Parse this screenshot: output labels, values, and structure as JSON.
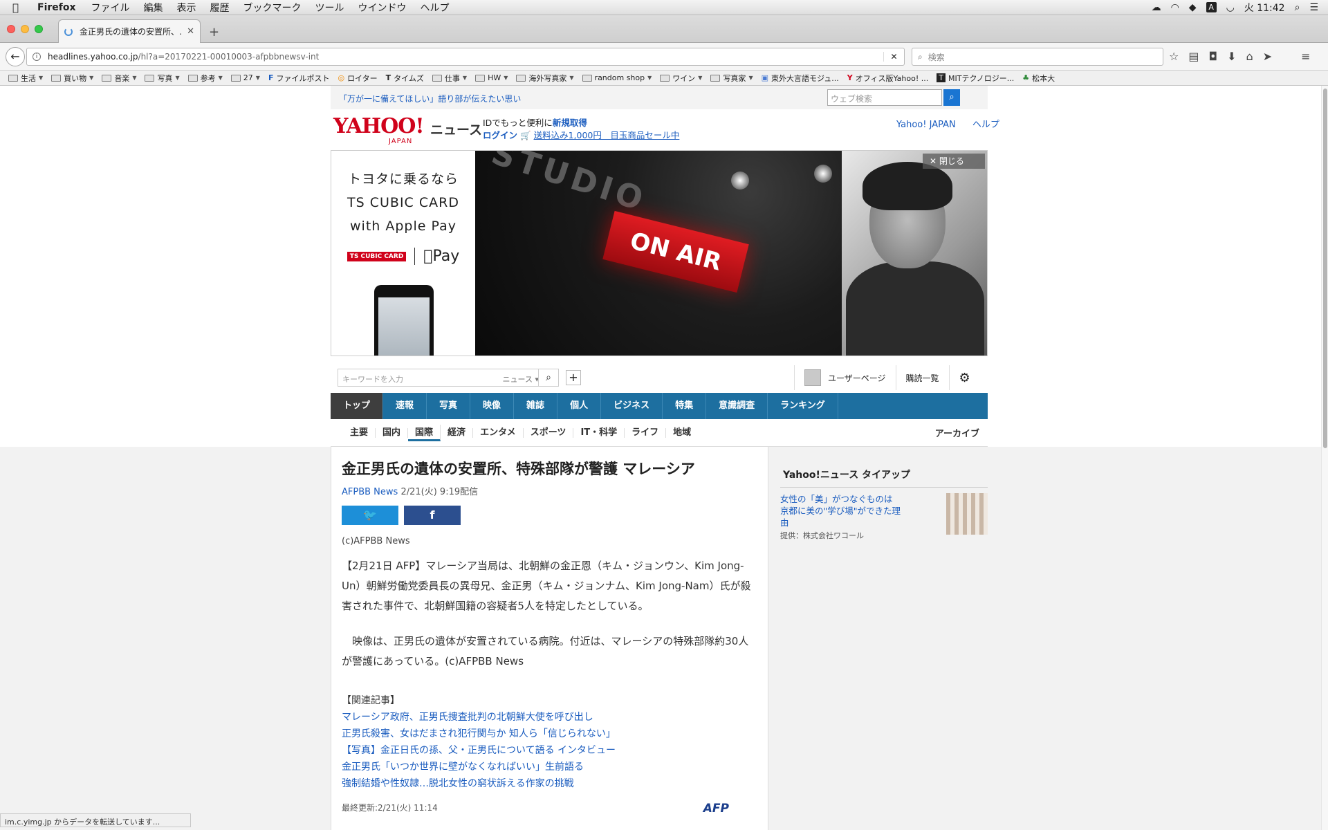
{
  "menubar": {
    "app": "Firefox",
    "items": [
      "ファイル",
      "編集",
      "表示",
      "履歴",
      "ブックマーク",
      "ツール",
      "ウインドウ",
      "ヘルプ"
    ],
    "clock": "火 11:42"
  },
  "tab": {
    "title": "金正男氏の遺体の安置所、…"
  },
  "url": {
    "host": "headlines.yahoo.co.jp",
    "path": "/hl?a=20170221-00010003-afpbbnewsv-int"
  },
  "search": {
    "placeholder": "検索"
  },
  "bookmarks": [
    {
      "label": "生活",
      "type": "folder"
    },
    {
      "label": "買い物",
      "type": "folder"
    },
    {
      "label": "音楽",
      "type": "folder"
    },
    {
      "label": "写真",
      "type": "folder"
    },
    {
      "label": "参考",
      "type": "folder"
    },
    {
      "label": "27",
      "type": "folder"
    },
    {
      "label": "ファイルポスト",
      "type": "site"
    },
    {
      "label": "ロイター",
      "type": "site"
    },
    {
      "label": "タイムズ",
      "type": "site"
    },
    {
      "label": "仕事",
      "type": "folder"
    },
    {
      "label": "HW",
      "type": "folder"
    },
    {
      "label": "海外写真家",
      "type": "folder"
    },
    {
      "label": "random shop",
      "type": "folder"
    },
    {
      "label": "ワイン",
      "type": "folder"
    },
    {
      "label": "写真家",
      "type": "folder"
    },
    {
      "label": "東外大言語モジュ...",
      "type": "site"
    },
    {
      "label": "オフィス版Yahoo! ...",
      "type": "site"
    },
    {
      "label": "MITテクノロジー...",
      "type": "site"
    },
    {
      "label": "松本大",
      "type": "site"
    }
  ],
  "yahoo": {
    "top_message": "「万が一に備えてほしい」語り部が伝えたい思い",
    "websearch_placeholder": "ウェブ検索",
    "logo_text": "YAHOO!",
    "logo_japan": "JAPAN",
    "logo_news": "ニュース",
    "id_text": "IDでもっと便利に",
    "signup": "新規取得",
    "login": "ログイン",
    "promo": "送料込み1,000円　目玉商品セール中",
    "link_japan": "Yahoo! JAPAN",
    "link_help": "ヘルプ"
  },
  "ad": {
    "line1": "トヨタに乗るなら",
    "line2": "TS CUBIC CARD",
    "line3": "with Apple Pay",
    "brand_ts": "TS CUBIC CARD",
    "brand_pay": "Pay",
    "studio": "STUDIO",
    "on_air": "ON AIR",
    "close": "閉じる"
  },
  "toolbar": {
    "keyword_placeholder": "キーワードを入力",
    "scope": "ニュース",
    "user_page": "ユーザーページ",
    "subscriptions": "購読一覧"
  },
  "mainnav": [
    "トップ",
    "速報",
    "写真",
    "映像",
    "雑誌",
    "個人",
    "ビジネス",
    "特集",
    "意識調査",
    "ランキング"
  ],
  "subnav": [
    "主要",
    "国内",
    "国際",
    "経済",
    "エンタメ",
    "スポーツ",
    "IT・科学",
    "ライフ",
    "地域"
  ],
  "archive": "アーカイブ",
  "article": {
    "title": "金正男氏の遺体の安置所、特殊部隊が警護 マレーシア",
    "source": "AFPBB News",
    "date": "2/21(火) 9:19配信",
    "credit": "(c)AFPBB News",
    "p1": "【2月21日 AFP】マレーシア当局は、北朝鮮の金正恩（キム・ジョンウン、Kim Jong-Un）朝鮮労働党委員長の異母兄、金正男（キム・ジョンナム、Kim Jong-Nam）氏が殺害された事件で、北朝鮮国籍の容疑者5人を特定したとしている。",
    "p2": "　映像は、正男氏の遺体が安置されている病院。付近は、マレーシアの特殊部隊約30人が警護にあっている。(c)AFPBB News",
    "related_heading": "【関連記事】",
    "related": [
      "マレーシア政府、正男氏捜査批判の北朝鮮大使を呼び出し",
      "正男氏殺害、女はだまされ犯行関与か 知人ら「信じられない」",
      "【写真】金正日氏の孫、父・正男氏について語る インタビュー",
      "金正男氏「いつか世界に壁がなくなればいい」生前語る",
      "強制結婚や性奴隷…脱北女性の窮状訴える作家の挑戦"
    ],
    "updated": "最終更新:2/21(火) 11:14",
    "afp_logo": "AFP"
  },
  "sidebar": {
    "heading": "Yahoo!ニュース タイアップ",
    "item_title": "女性の「美」がつなぐものは　京都に美の\"学び場\"ができた理由",
    "item_provider": "提供：株式会社ワコール"
  },
  "status": "im.c.yimg.jp からデータを転送しています..."
}
